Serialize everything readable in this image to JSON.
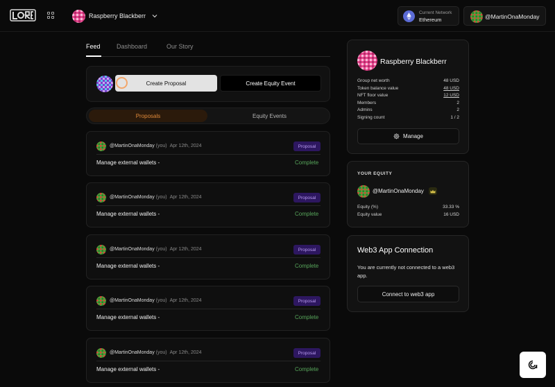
{
  "header": {
    "group_name": "Raspberry Blackberr",
    "network_label": "Current Network",
    "network_value": "Ethereum",
    "user_name": "@MartinOnaMonday"
  },
  "tabs": [
    {
      "label": "Feed",
      "active": true
    },
    {
      "label": "Dashboard",
      "active": false
    },
    {
      "label": "Our Story",
      "active": false
    }
  ],
  "create": {
    "proposal_label": "Create Proposal",
    "equity_label": "Create Equity Event"
  },
  "segments": {
    "proposals": "Proposals",
    "equity_events": "Equity Events"
  },
  "feed": [
    {
      "user": "@MartinOnaMonday",
      "you": "(you)",
      "date": "Apr 12th, 2024",
      "badge": "Proposal",
      "title": "Manage external wallets -",
      "status": "Complete"
    },
    {
      "user": "@MartinOnaMonday",
      "you": "(you)",
      "date": "Apr 12th, 2024",
      "badge": "Proposal",
      "title": "Manage external wallets -",
      "status": "Complete"
    },
    {
      "user": "@MartinOnaMonday",
      "you": "(you)",
      "date": "Apr 12th, 2024",
      "badge": "Proposal",
      "title": "Manage external wallets -",
      "status": "Complete"
    },
    {
      "user": "@MartinOnaMonday",
      "you": "(you)",
      "date": "Apr 12th, 2024",
      "badge": "Proposal",
      "title": "Manage external wallets -",
      "status": "Complete"
    },
    {
      "user": "@MartinOnaMonday",
      "you": "(you)",
      "date": "Apr 12th, 2024",
      "badge": "Proposal",
      "title": "Manage external wallets -",
      "status": "Complete"
    }
  ],
  "group_card": {
    "title": "Raspberry Blackberr",
    "stats": [
      {
        "label": "Group net worth",
        "value": "48 USD",
        "link": false
      },
      {
        "label": "Token balance value",
        "value": "48 USD",
        "link": true
      },
      {
        "label": "NFT floor value",
        "value": "12 USD",
        "link": true
      },
      {
        "label": "Members",
        "value": "2",
        "link": false
      },
      {
        "label": "Admins",
        "value": "2",
        "link": false
      },
      {
        "label": "Signing count",
        "value": "1 / 2",
        "link": false
      }
    ],
    "manage_label": "Manage"
  },
  "equity_card": {
    "heading": "YOUR EQUITY",
    "user": "@MartinOnaMonday",
    "stats": [
      {
        "label": "Equity (%)",
        "value": "33.33 %"
      },
      {
        "label": "Equity value",
        "value": "16 USD"
      }
    ]
  },
  "web3_card": {
    "title": "Web3 App Connection",
    "text": "You are currently not connected to a web3 app.",
    "button": "Connect to web3 app"
  },
  "colors": {
    "accent_orange": "#e08a3a",
    "complete_green": "#57a65b",
    "badge_purple": "#2d1760"
  }
}
